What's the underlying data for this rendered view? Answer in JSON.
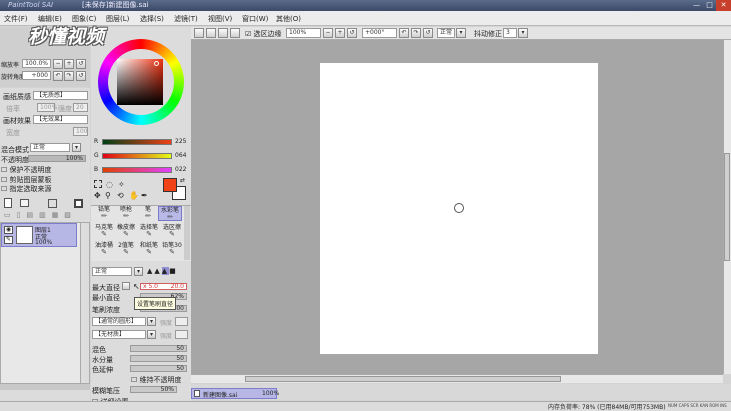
{
  "title": {
    "app": "PaintTool SAI",
    "doc": "[未保存]新建图像.sai"
  },
  "watermark": "秒懂视频",
  "window_controls": [
    "—",
    "□",
    "✕"
  ],
  "menu": [
    "文件(F)",
    "编辑(E)",
    "图象(C)",
    "图层(L)",
    "选择(S)",
    "滤镜(T)",
    "视图(V)",
    "窗口(W)",
    "其他(O)"
  ],
  "nav": {
    "zoom_label": "缩放率",
    "zoom_value": "100.0%",
    "angle_label": "旋转角度",
    "angle_value": "+000"
  },
  "layer_props": {
    "paper_texture_label": "画纸质感",
    "paper_texture_value": "【无质感】",
    "scale_label": "倍率",
    "scale_value": "100%",
    "intensity_label": "强度",
    "intensity_value": "20",
    "paper_effect_label": "画材效果",
    "paper_effect_value": "【无效果】",
    "width_label": "宽度",
    "width_value": "100",
    "blend_label": "混合模式",
    "blend_value": "正常",
    "opacity_label": "不透明度",
    "opacity_value": "100%",
    "check1": "保护不透明度",
    "check2": "剪贴图层蒙板",
    "check3": "指定选取来源"
  },
  "layer": {
    "name": "图层1",
    "mode": "正常",
    "opacity": "100%"
  },
  "color": {
    "r": "225",
    "g": "064",
    "b": "022",
    "fg": "#f04418"
  },
  "tools": {
    "row1": [
      "铅笔",
      "喷枪",
      "笔",
      "水彩笔"
    ],
    "row2": [
      "马克笔",
      "橡皮擦",
      "选择笔",
      "选区擦"
    ],
    "row3": [
      "油漆桶",
      "2值笔",
      "和纸笔",
      "铅笔30"
    ]
  },
  "brush": {
    "mode": "正常",
    "max_size_label": "最大直径",
    "max_size_mult": "x 5.0",
    "max_size_value": "20.0",
    "min_size_label": "最小直径",
    "min_size_value": "62%",
    "density_label": "笔刷浓度",
    "density_value": "100",
    "tooltip": "设置笔刷直径",
    "shape": "【通常的圆形】",
    "shape_strength": "强度",
    "texture": "【无材质】",
    "texture_strength": "强度",
    "blend_label": "混色",
    "blend_value": "50",
    "water_label": "水分量",
    "water_value": "50",
    "stretch_label": "色延伸",
    "stretch_value": "50",
    "keep_opacity": "维持不透明度",
    "blur_label": "模糊笔压",
    "blur_value": "50%",
    "detail": "详细设置"
  },
  "toolbar": {
    "select_edge": "选区边缘",
    "zoom": "100%",
    "angle": "+000°",
    "mode": "正常",
    "stabilizer_label": "抖动修正",
    "stabilizer_value": "3"
  },
  "tab": {
    "name": "新建图像.sai",
    "zoom": "100%"
  },
  "status": {
    "memory": "内存负荷率: 78% (已用84MB/可用753MB)",
    "indicators": "NUM CAPS SCR KAN ROM INS"
  }
}
